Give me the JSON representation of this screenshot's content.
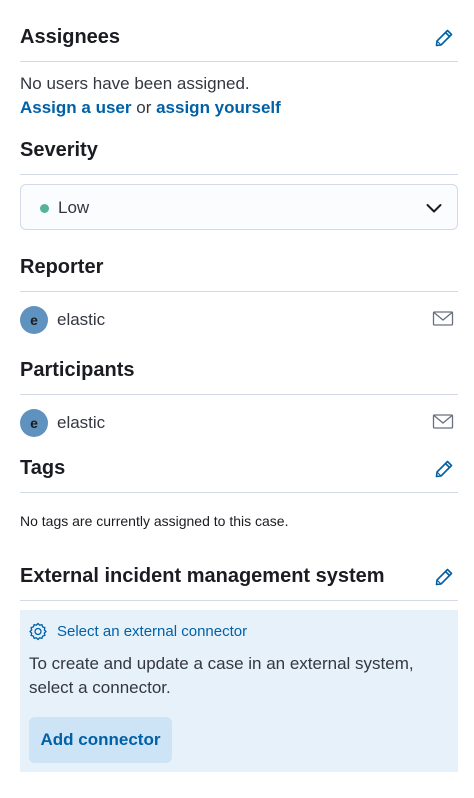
{
  "assignees": {
    "title": "Assignees",
    "empty_text": "No users have been assigned.",
    "assign_user_link": "Assign a user",
    "or_text": "or",
    "assign_yourself_link": "assign yourself"
  },
  "severity": {
    "title": "Severity",
    "selected": "Low",
    "dot_color": "#54b399"
  },
  "reporter": {
    "title": "Reporter",
    "user": {
      "initial": "e",
      "name": "elastic"
    }
  },
  "participants": {
    "title": "Participants",
    "users": [
      {
        "initial": "e",
        "name": "elastic"
      }
    ]
  },
  "tags": {
    "title": "Tags",
    "empty_text": "No tags are currently assigned to this case."
  },
  "connector": {
    "title": "External incident management system",
    "callout_title": "Select an external connector",
    "callout_body": "To create and update a case in an external system, select a connector.",
    "add_button_label": "Add connector"
  },
  "colors": {
    "link": "#0061a6",
    "avatar": "#6092c0",
    "callout_bg": "#e6f1fa",
    "button_bg": "#cce4f5",
    "divider": "#d3dae6"
  },
  "icons": {
    "edit": "pencil-icon",
    "mail": "envelope-icon",
    "chevron": "chevron-down-icon",
    "gear": "gear-icon"
  }
}
